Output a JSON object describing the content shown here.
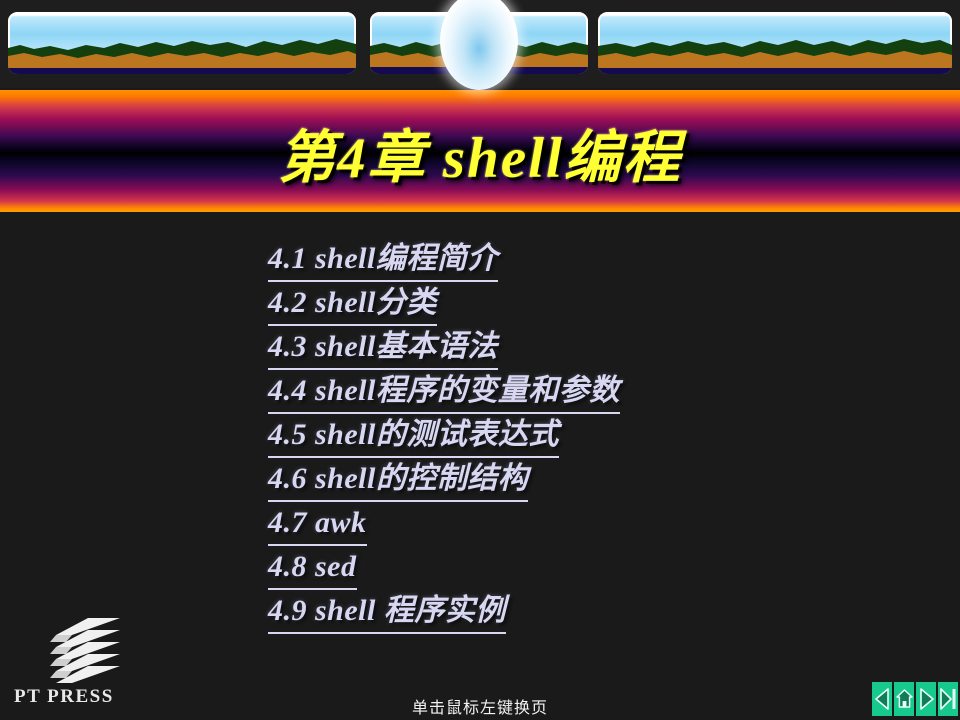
{
  "slide": {
    "background_color": "#1a1a1a",
    "title": "第4章  shell编程",
    "title_color": "#ffff33",
    "footer_hint": "单击鼠标左键换页"
  },
  "toc": {
    "items": [
      {
        "label": "4.1  shell编程简介"
      },
      {
        "label": "4.2  shell分类"
      },
      {
        "label": "4.3  shell基本语法"
      },
      {
        "label": "4.4  shell程序的变量和参数"
      },
      {
        "label": "4.5  shell的测试表达式"
      },
      {
        "label": "4.6  shell的控制结构"
      },
      {
        "label": "4.7  awk"
      },
      {
        "label": "4.8  sed"
      },
      {
        "label": "4.9  shell 程序实例"
      }
    ],
    "text_color": "#d7d7f2"
  },
  "logo": {
    "text": "PT PRESS",
    "mark": "stacked-chevron-book-icon"
  },
  "nav": {
    "buttons": [
      {
        "name": "previous-slide-button",
        "icon": "triangle-left-icon",
        "label": "◁"
      },
      {
        "name": "home-slide-button",
        "icon": "home-icon",
        "label": "⌂"
      },
      {
        "name": "next-slide-button",
        "icon": "triangle-right-icon",
        "label": "▷"
      },
      {
        "name": "last-slide-button",
        "icon": "triangle-right-bar-icon",
        "label": "▷|"
      }
    ],
    "button_color": "#18c98d"
  },
  "decor": {
    "top_banner": "landscape-triptych",
    "panels": [
      "landscape-panel-left",
      "landscape-panel-center",
      "landscape-panel-right"
    ],
    "orb": "glowing-orb-ellipse",
    "title_banner_gradient": [
      "#ff9000",
      "#9c0d55",
      "#000000",
      "#8b0c55",
      "#ff9c00"
    ]
  }
}
